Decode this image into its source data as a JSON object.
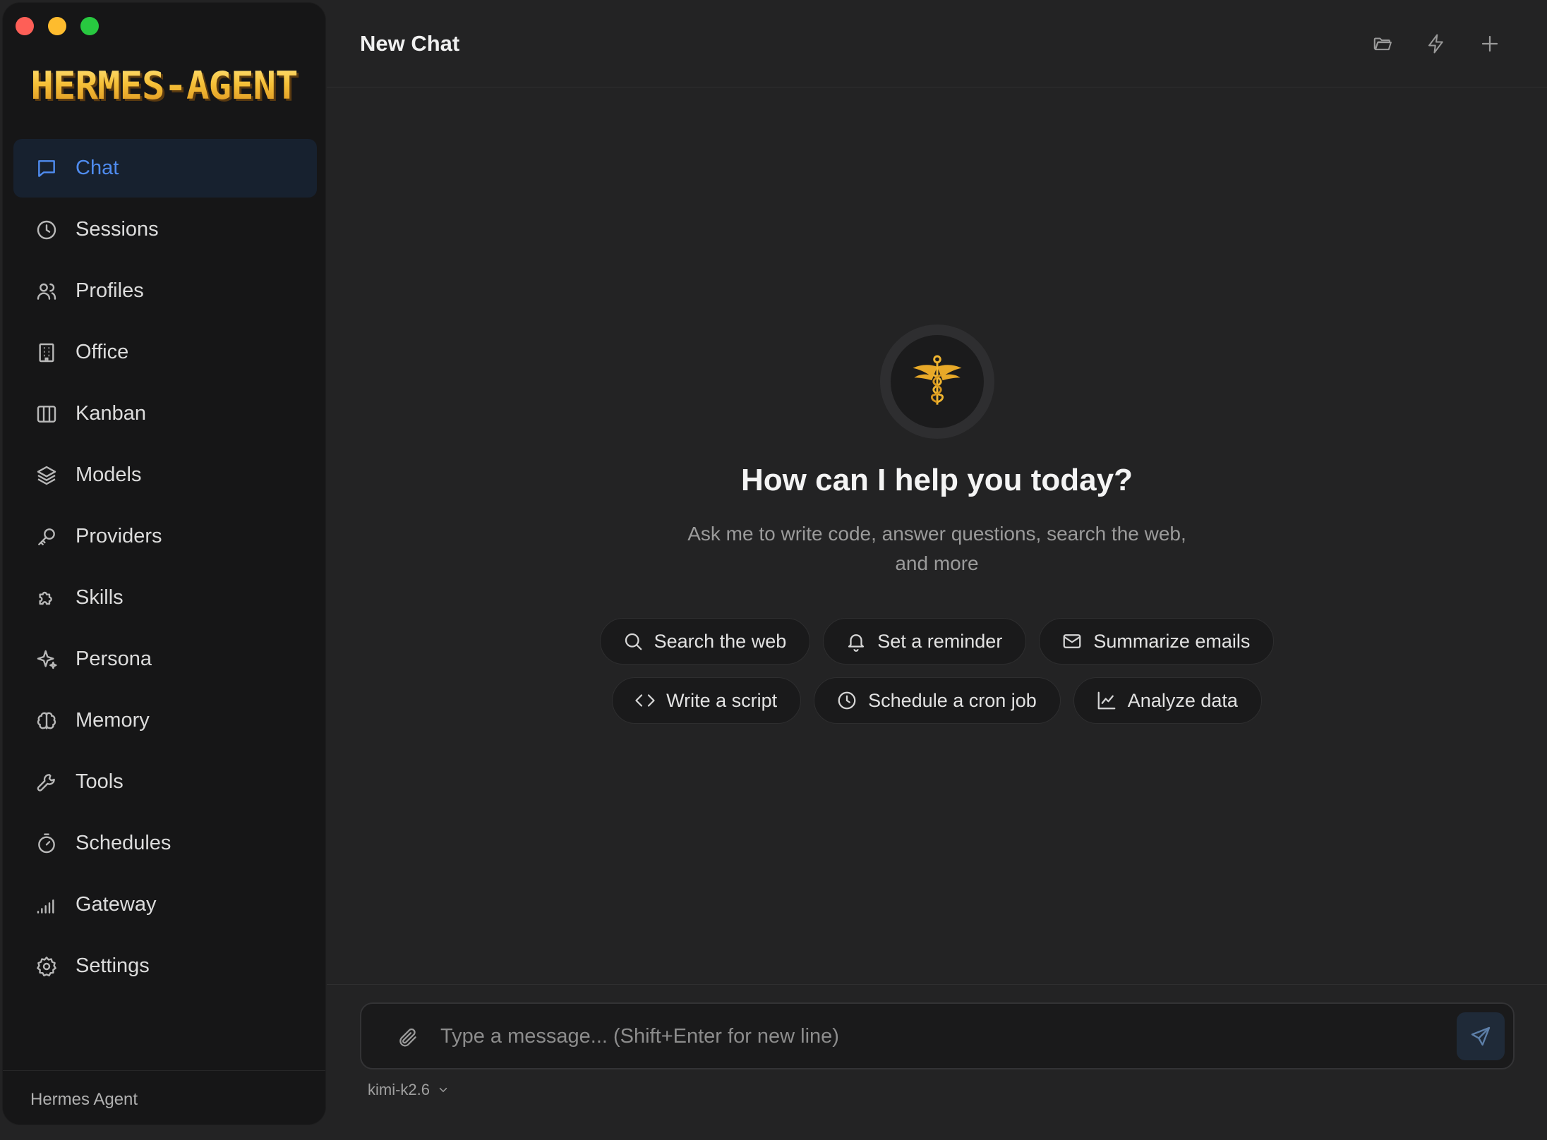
{
  "window": {
    "controls": {
      "close_color": "#fe5f57",
      "minimize_color": "#febc2e",
      "zoom_color": "#28c840"
    }
  },
  "sidebar": {
    "logo_text": "HERMES-AGENT",
    "items": [
      {
        "label": "Chat",
        "icon": "chat-icon",
        "active": true
      },
      {
        "label": "Sessions",
        "icon": "clock-icon"
      },
      {
        "label": "Profiles",
        "icon": "users-icon"
      },
      {
        "label": "Office",
        "icon": "building-icon"
      },
      {
        "label": "Kanban",
        "icon": "columns-icon"
      },
      {
        "label": "Models",
        "icon": "layers-icon"
      },
      {
        "label": "Providers",
        "icon": "key-icon"
      },
      {
        "label": "Skills",
        "icon": "puzzle-icon"
      },
      {
        "label": "Persona",
        "icon": "sparkles-icon"
      },
      {
        "label": "Memory",
        "icon": "brain-icon"
      },
      {
        "label": "Tools",
        "icon": "wrench-icon"
      },
      {
        "label": "Schedules",
        "icon": "timer-icon"
      },
      {
        "label": "Gateway",
        "icon": "signal-icon"
      },
      {
        "label": "Settings",
        "icon": "gear-icon"
      }
    ],
    "footer": "Hermes Agent"
  },
  "header": {
    "title": "New Chat",
    "actions": [
      "folder-icon",
      "lightning-icon",
      "plus-icon"
    ]
  },
  "welcome": {
    "avatar_icon": "caduceus-icon",
    "title": "How can I help you today?",
    "subtitle": "Ask me to write code, answer questions, search the web, and more"
  },
  "suggestions": {
    "row1": [
      {
        "label": "Search the web",
        "icon": "search-icon"
      },
      {
        "label": "Set a reminder",
        "icon": "bell-icon"
      },
      {
        "label": "Summarize emails",
        "icon": "mail-icon"
      }
    ],
    "row2": [
      {
        "label": "Write a script",
        "icon": "code-icon"
      },
      {
        "label": "Schedule a cron job",
        "icon": "clock-icon"
      },
      {
        "label": "Analyze data",
        "icon": "chart-icon"
      }
    ]
  },
  "composer": {
    "placeholder": "Type a message... (Shift+Enter for new line)",
    "value": "",
    "model": "kimi-k2.6"
  },
  "colors": {
    "accent": "#4f8cf0",
    "logo_gold": "#f5c038",
    "background": "#232324",
    "sidebar_bg": "#161617"
  }
}
